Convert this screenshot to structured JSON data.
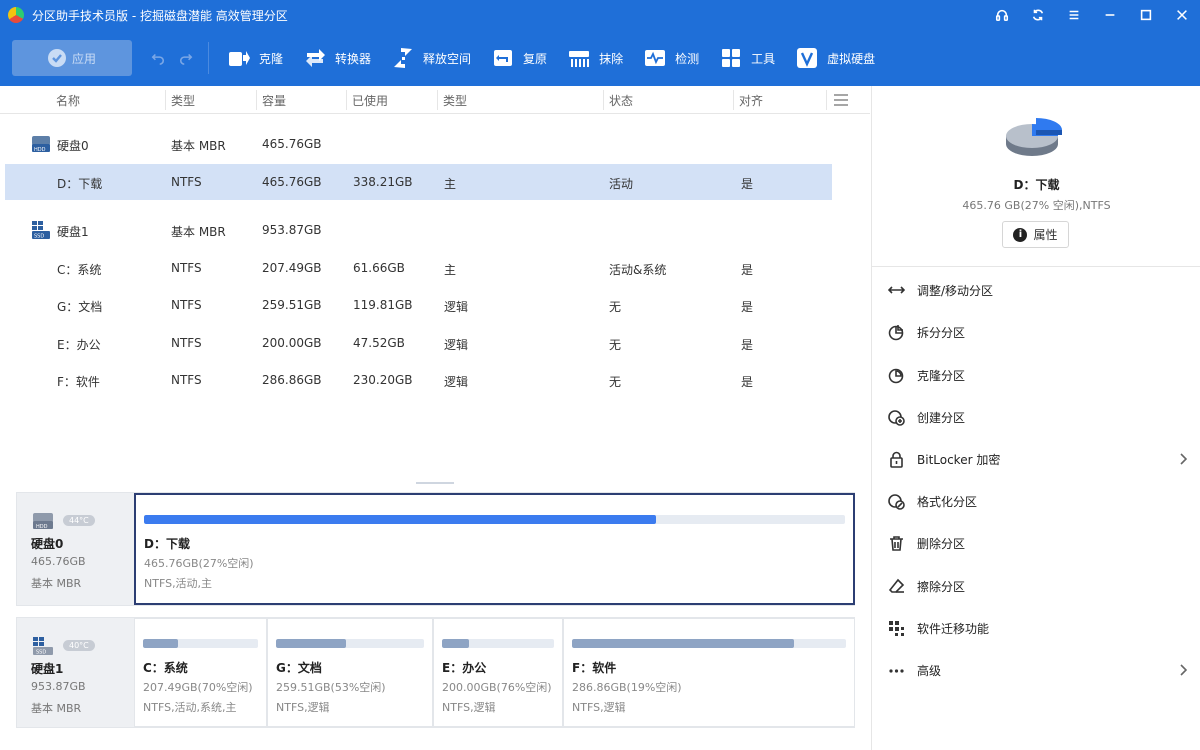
{
  "window": {
    "title": "分区助手技术员版 - 挖掘磁盘潜能 高效管理分区"
  },
  "toolbar": {
    "apply_label": "应用",
    "items": [
      {
        "label": "克隆",
        "icon": "clone-icon"
      },
      {
        "label": "转换器",
        "icon": "converter-icon"
      },
      {
        "label": "释放空间",
        "icon": "free-space-icon"
      },
      {
        "label": "复原",
        "icon": "restore-icon"
      },
      {
        "label": "抹除",
        "icon": "wipe-icon"
      },
      {
        "label": "检测",
        "icon": "detect-icon"
      },
      {
        "label": "工具",
        "icon": "tools-icon"
      },
      {
        "label": "虚拟硬盘",
        "icon": "virtual-disk-icon"
      }
    ]
  },
  "table": {
    "headers": [
      "名称",
      "类型",
      "容量",
      "已使用",
      "类型",
      "状态",
      "对齐"
    ],
    "disks": [
      {
        "name": "硬盘0",
        "type": "基本 MBR",
        "capacity": "465.76GB",
        "icon": "hdd-icon",
        "partitions": [
          {
            "name": "D：下载",
            "fs": "NTFS",
            "capacity": "465.76GB",
            "used": "338.21GB",
            "ptype": "主",
            "status": "活动",
            "align": "是",
            "selected": true
          }
        ]
      },
      {
        "name": "硬盘1",
        "type": "基本 MBR",
        "capacity": "953.87GB",
        "icon": "ssd-icon",
        "partitions": [
          {
            "name": "C：系统",
            "fs": "NTFS",
            "capacity": "207.49GB",
            "used": "61.66GB",
            "ptype": "主",
            "status": "活动&系统",
            "align": "是"
          },
          {
            "name": "G：文档",
            "fs": "NTFS",
            "capacity": "259.51GB",
            "used": "119.81GB",
            "ptype": "逻辑",
            "status": "无",
            "align": "是"
          },
          {
            "name": "E：办公",
            "fs": "NTFS",
            "capacity": "200.00GB",
            "used": "47.52GB",
            "ptype": "逻辑",
            "status": "无",
            "align": "是"
          },
          {
            "name": "F：软件",
            "fs": "NTFS",
            "capacity": "286.86GB",
            "used": "230.20GB",
            "ptype": "逻辑",
            "status": "无",
            "align": "是"
          }
        ]
      }
    ]
  },
  "diskmap": [
    {
      "name": "硬盘0",
      "size": "465.76GB",
      "type": "基本 MBR",
      "temp": "44°C",
      "icon": "hdd-icon",
      "partitions": [
        {
          "name": "D：下载",
          "detail": "465.76GB(27%空闲)",
          "fs": "NTFS,活动,主",
          "used_fraction": 0.73,
          "selected": true
        }
      ]
    },
    {
      "name": "硬盘1",
      "size": "953.87GB",
      "type": "基本 MBR",
      "temp": "40°C",
      "icon": "ssd-icon",
      "partitions": [
        {
          "name": "C：系统",
          "detail": "207.49GB(70%空闲)",
          "fs": "NTFS,活动,系统,主",
          "used_fraction": 0.3
        },
        {
          "name": "G：文档",
          "detail": "259.51GB(53%空闲)",
          "fs": "NTFS,逻辑",
          "used_fraction": 0.47
        },
        {
          "name": "E：办公",
          "detail": "200.00GB(76%空闲)",
          "fs": "NTFS,逻辑",
          "used_fraction": 0.24
        },
        {
          "name": "F：软件",
          "detail": "286.86GB(19%空闲)",
          "fs": "NTFS,逻辑",
          "used_fraction": 0.81
        }
      ]
    }
  ],
  "panel": {
    "selected_name": "D：下载",
    "selected_info": "465.76 GB(27% 空闲),NTFS",
    "properties_label": "属性",
    "used_fraction": 0.73,
    "operations": [
      {
        "label": "调整/移动分区",
        "icon": "resize-icon"
      },
      {
        "label": "拆分分区",
        "icon": "split-icon"
      },
      {
        "label": "克隆分区",
        "icon": "clone-partition-icon"
      },
      {
        "label": "创建分区",
        "icon": "create-partition-icon"
      },
      {
        "label": "BitLocker 加密",
        "icon": "lock-icon",
        "submenu": true
      },
      {
        "label": "格式化分区",
        "icon": "format-icon"
      },
      {
        "label": "删除分区",
        "icon": "trash-icon"
      },
      {
        "label": "擦除分区",
        "icon": "eraser-icon"
      },
      {
        "label": "软件迁移功能",
        "icon": "migrate-icon"
      },
      {
        "label": "高级",
        "icon": "more-icon",
        "submenu": true
      }
    ]
  },
  "colors": {
    "accent": "#1f6fd8",
    "used_bar": "#3b7bef",
    "used_bar_gray": "#8ea4c4",
    "selected_row": "#d3e1f6"
  }
}
